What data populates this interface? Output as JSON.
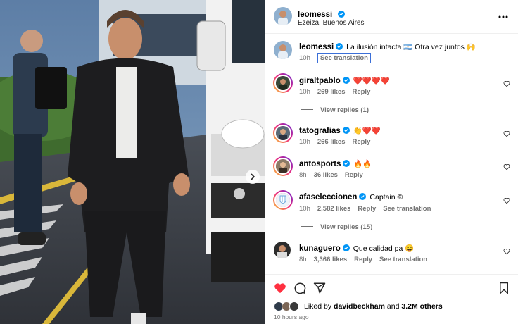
{
  "post": {
    "author": "leomessi",
    "location": "Ezeiza, Buenos Aires",
    "caption": "La ilusión intacta 🇦🇷 Otra vez juntos 🙌",
    "caption_age": "10h",
    "see_translation": "See translation"
  },
  "comments": [
    {
      "user": "giraltpablo",
      "verified": true,
      "text": "❤️❤️❤️❤️",
      "age": "10h",
      "likes": "269 likes",
      "reply": "Reply",
      "translation": "",
      "replies": "View replies (1)"
    },
    {
      "user": "tatografias",
      "verified": true,
      "text": "👏❤️❤️",
      "age": "10h",
      "likes": "266 likes",
      "reply": "Reply",
      "translation": "",
      "replies": ""
    },
    {
      "user": "antosports",
      "verified": true,
      "text": "🔥🔥",
      "age": "8h",
      "likes": "36 likes",
      "reply": "Reply",
      "translation": "",
      "replies": ""
    },
    {
      "user": "afaseleccionen",
      "verified": true,
      "text": "Captain ©",
      "age": "10h",
      "likes": "2,582 likes",
      "reply": "Reply",
      "translation": "See translation",
      "replies": "View replies (15)"
    },
    {
      "user": "kunaguero",
      "verified": true,
      "text": "Que calidad pa 😄",
      "age": "8h",
      "likes": "3,366 likes",
      "reply": "Reply",
      "translation": "See translation",
      "replies": ""
    }
  ],
  "likes": {
    "prefix": "Liked by",
    "user": "davidbeckham",
    "middle": "and",
    "others": "3.2M others"
  },
  "time_ago": "10 hours ago",
  "icons": {
    "like": "heart-filled-icon",
    "comment": "comment-icon",
    "share": "share-icon",
    "save": "bookmark-icon",
    "more": "more-horizontal-icon",
    "next": "chevron-right-icon"
  },
  "colors": {
    "verified": "#0095f6",
    "like_red": "#ff3040",
    "focus_outline": "#3b6fd8",
    "muted_text": "#737373"
  }
}
